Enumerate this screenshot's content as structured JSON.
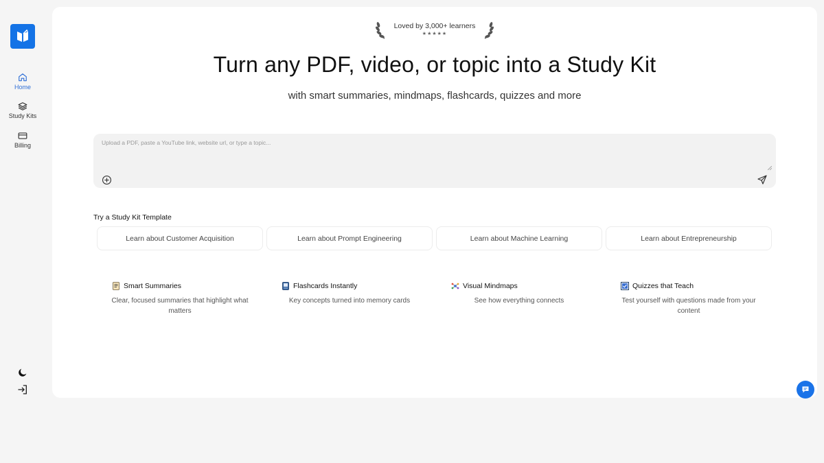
{
  "sidebar": {
    "logo_icon": "book-logo-icon",
    "items": [
      {
        "label": "Home",
        "icon": "home-icon"
      },
      {
        "label": "Study Kits",
        "icon": "layers-icon"
      },
      {
        "label": "Billing",
        "icon": "credit-card-icon"
      }
    ],
    "bottom_icons": [
      "moon-icon",
      "logout-icon"
    ]
  },
  "badge": {
    "text": "Loved by 3,000+ learners",
    "stars": "★★★★★"
  },
  "hero": {
    "title": "Turn any PDF, video, or topic into a Study Kit",
    "subtitle": "with smart summaries, mindmaps, flashcards, quizzes and more"
  },
  "composer": {
    "placeholder": "Upload a PDF, paste a YouTube link, website url, or type a topic...",
    "value": ""
  },
  "templates": {
    "title": "Try a Study Kit Template",
    "items": [
      "Learn about Customer Acquisition",
      "Learn about Prompt Engineering",
      "Learn about Machine Learning",
      "Learn about Entrepreneurship"
    ]
  },
  "features": [
    {
      "title": "Smart Summaries",
      "desc": "Clear, focused summaries that highlight what matters",
      "icon": "document-icon"
    },
    {
      "title": "Flashcards Instantly",
      "desc": "Key concepts turned into memory cards",
      "icon": "flashcard-icon"
    },
    {
      "title": "Visual Mindmaps",
      "desc": "See how everything connects",
      "icon": "mindmap-icon"
    },
    {
      "title": "Quizzes that Teach",
      "desc": "Test yourself with questions made from your content",
      "icon": "quiz-icon"
    }
  ],
  "colors": {
    "accent": "#1a73e8",
    "active_nav": "#2f6fd6",
    "background": "#f5f5f5",
    "card": "#ffffff"
  }
}
